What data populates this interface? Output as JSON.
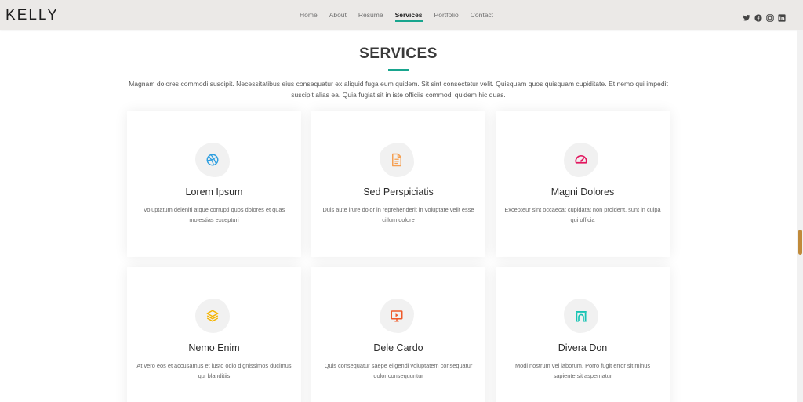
{
  "brand": "KELLY",
  "nav": [
    "Home",
    "About",
    "Resume",
    "Services",
    "Portfolio",
    "Contact"
  ],
  "nav_active": "Services",
  "social_icons": [
    "twitter-icon",
    "facebook-icon",
    "instagram-icon",
    "linkedin-icon"
  ],
  "section": {
    "title": "SERVICES",
    "intro": "Magnam dolores commodi suscipit. Necessitatibus eius consequatur ex aliquid fuga eum quidem. Sit sint consectetur velit. Quisquam quos quisquam cupiditate. Et nemo qui impedit suscipit alias ea. Quia fugiat sit in iste officiis commodi quidem hic quas.",
    "accent_color": "#18a58e"
  },
  "services": [
    {
      "title": "Lorem Ipsum",
      "desc": "Voluptatum deleniti atque corrupti quos dolores et quas molestias excepturi",
      "icon": "dribbble-icon",
      "color": "#2f9fe0"
    },
    {
      "title": "Sed Perspiciatis",
      "desc": "Duis aute irure dolor in reprehenderit in voluptate velit esse cillum dolore",
      "icon": "file-text-icon",
      "color": "#f5a052"
    },
    {
      "title": "Magni Dolores",
      "desc": "Excepteur sint occaecat cupidatat non proident, sunt in culpa qui officia",
      "icon": "speedometer-icon",
      "color": "#e2175f"
    },
    {
      "title": "Nemo Enim",
      "desc": "At vero eos et accusamus et iusto odio dignissimos ducimus qui blanditiis",
      "icon": "layers-icon",
      "color": "#f5b400"
    },
    {
      "title": "Dele Cardo",
      "desc": "Quis consequatur saepe eligendi voluptatem consequatur dolor consequuntur",
      "icon": "presentation-icon",
      "color": "#ef5a2a"
    },
    {
      "title": "Divera Don",
      "desc": "Modi nostrum vel laborum. Porro fugit error sit minus sapiente sit aspernatur",
      "icon": "archway-icon",
      "color": "#17c4b4"
    }
  ]
}
